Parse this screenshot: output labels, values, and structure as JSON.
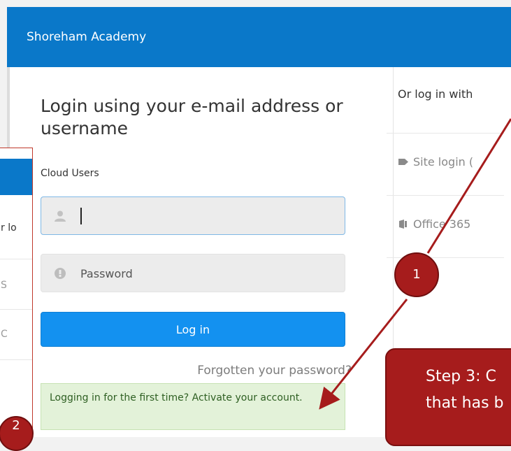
{
  "header": {
    "title": "Shoreham Academy"
  },
  "login": {
    "heading": "Login using your e-mail address or username",
    "section_label": "Cloud Users",
    "username_value": "",
    "password_placeholder": "Password",
    "login_button": "Log in",
    "forgot_link": "Forgotten your password?",
    "first_time_text": "Logging in for the first time? Activate your account."
  },
  "alt_login": {
    "heading": "Or log in with",
    "site_login": "Site login (",
    "office365": "Office 365"
  },
  "inset": {
    "text1": "r lo",
    "text2": "S",
    "text3": "C"
  },
  "annotations": {
    "callout_1": "1",
    "callout_2": "2",
    "step_line1": "Step 3: C",
    "step_line2": "that has b"
  },
  "icons": {
    "user": "user-icon",
    "password": "password-icon",
    "site": "site-login-icon",
    "office": "office-icon"
  },
  "colors": {
    "brand": "#0a78c9",
    "button": "#1391f0",
    "annotation": "#a61c1c",
    "success_bg": "#e3f2d9"
  }
}
